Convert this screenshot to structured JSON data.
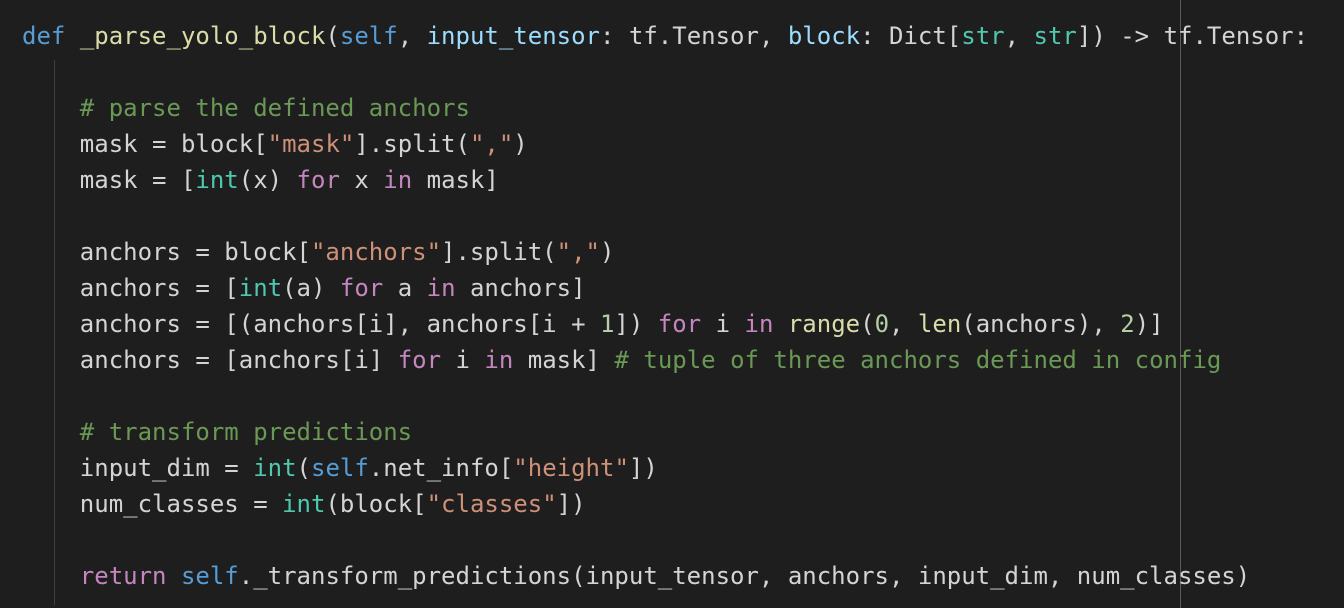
{
  "editor": {
    "language": "python",
    "theme_colors": {
      "background": "#1e1e1e",
      "keyword": "#569cd6",
      "function": "#dcdcaa",
      "parameter": "#9cdcfe",
      "type": "#4ec9b0",
      "string": "#ce9178",
      "number": "#b5cea8",
      "comment": "#6a9955",
      "control": "#c586c0",
      "plain": "#d4d4d4"
    },
    "lines": [
      {
        "tokens": [
          {
            "t": "kw",
            "v": "def"
          },
          {
            "t": "plain",
            "v": " "
          },
          {
            "t": "fn",
            "v": "_parse_yolo_block"
          },
          {
            "t": "plain",
            "v": "("
          },
          {
            "t": "self",
            "v": "self"
          },
          {
            "t": "plain",
            "v": ", "
          },
          {
            "t": "param",
            "v": "input_tensor"
          },
          {
            "t": "plain",
            "v": ": tf.Tensor, "
          },
          {
            "t": "param",
            "v": "block"
          },
          {
            "t": "plain",
            "v": ": Dict["
          },
          {
            "t": "type",
            "v": "str"
          },
          {
            "t": "plain",
            "v": ", "
          },
          {
            "t": "type",
            "v": "str"
          },
          {
            "t": "plain",
            "v": "]) -> tf.Tensor:"
          }
        ]
      },
      {
        "tokens": []
      },
      {
        "tokens": [
          {
            "t": "plain",
            "v": "    "
          },
          {
            "t": "cmt",
            "v": "# parse the defined anchors"
          }
        ]
      },
      {
        "tokens": [
          {
            "t": "plain",
            "v": "    mask = block["
          },
          {
            "t": "str",
            "v": "\"mask\""
          },
          {
            "t": "plain",
            "v": "].split("
          },
          {
            "t": "str",
            "v": "\",\""
          },
          {
            "t": "plain",
            "v": ")"
          }
        ]
      },
      {
        "tokens": [
          {
            "t": "plain",
            "v": "    mask = ["
          },
          {
            "t": "type",
            "v": "int"
          },
          {
            "t": "plain",
            "v": "(x) "
          },
          {
            "t": "ctl",
            "v": "for"
          },
          {
            "t": "plain",
            "v": " x "
          },
          {
            "t": "ctl",
            "v": "in"
          },
          {
            "t": "plain",
            "v": " mask]"
          }
        ]
      },
      {
        "tokens": []
      },
      {
        "tokens": [
          {
            "t": "plain",
            "v": "    anchors = block["
          },
          {
            "t": "str",
            "v": "\"anchors\""
          },
          {
            "t": "plain",
            "v": "].split("
          },
          {
            "t": "str",
            "v": "\",\""
          },
          {
            "t": "plain",
            "v": ")"
          }
        ]
      },
      {
        "tokens": [
          {
            "t": "plain",
            "v": "    anchors = ["
          },
          {
            "t": "type",
            "v": "int"
          },
          {
            "t": "plain",
            "v": "(a) "
          },
          {
            "t": "ctl",
            "v": "for"
          },
          {
            "t": "plain",
            "v": " a "
          },
          {
            "t": "ctl",
            "v": "in"
          },
          {
            "t": "plain",
            "v": " anchors]"
          }
        ]
      },
      {
        "tokens": [
          {
            "t": "plain",
            "v": "    anchors = [(anchors[i], anchors[i + "
          },
          {
            "t": "num",
            "v": "1"
          },
          {
            "t": "plain",
            "v": "]) "
          },
          {
            "t": "ctl",
            "v": "for"
          },
          {
            "t": "plain",
            "v": " i "
          },
          {
            "t": "ctl",
            "v": "in"
          },
          {
            "t": "plain",
            "v": " "
          },
          {
            "t": "fn",
            "v": "range"
          },
          {
            "t": "plain",
            "v": "("
          },
          {
            "t": "num",
            "v": "0"
          },
          {
            "t": "plain",
            "v": ", "
          },
          {
            "t": "fn",
            "v": "len"
          },
          {
            "t": "plain",
            "v": "(anchors), "
          },
          {
            "t": "num",
            "v": "2"
          },
          {
            "t": "plain",
            "v": ")]"
          }
        ]
      },
      {
        "tokens": [
          {
            "t": "plain",
            "v": "    anchors = [anchors[i] "
          },
          {
            "t": "ctl",
            "v": "for"
          },
          {
            "t": "plain",
            "v": " i "
          },
          {
            "t": "ctl",
            "v": "in"
          },
          {
            "t": "plain",
            "v": " mask] "
          },
          {
            "t": "cmt",
            "v": "# tuple of three anchors defined in config"
          }
        ]
      },
      {
        "tokens": []
      },
      {
        "tokens": [
          {
            "t": "plain",
            "v": "    "
          },
          {
            "t": "cmt",
            "v": "# transform predictions"
          }
        ]
      },
      {
        "tokens": [
          {
            "t": "plain",
            "v": "    input_dim = "
          },
          {
            "t": "type",
            "v": "int"
          },
          {
            "t": "plain",
            "v": "("
          },
          {
            "t": "self",
            "v": "self"
          },
          {
            "t": "plain",
            "v": ".net_info["
          },
          {
            "t": "str",
            "v": "\"height\""
          },
          {
            "t": "plain",
            "v": "])"
          }
        ]
      },
      {
        "tokens": [
          {
            "t": "plain",
            "v": "    num_classes = "
          },
          {
            "t": "type",
            "v": "int"
          },
          {
            "t": "plain",
            "v": "(block["
          },
          {
            "t": "str",
            "v": "\"classes\""
          },
          {
            "t": "plain",
            "v": "])"
          }
        ]
      },
      {
        "tokens": []
      },
      {
        "tokens": [
          {
            "t": "plain",
            "v": "    "
          },
          {
            "t": "ctl",
            "v": "return"
          },
          {
            "t": "plain",
            "v": " "
          },
          {
            "t": "self",
            "v": "self"
          },
          {
            "t": "plain",
            "v": "._transform_predictions(input_tensor, anchors, input_dim, num_classes)"
          }
        ]
      }
    ]
  }
}
